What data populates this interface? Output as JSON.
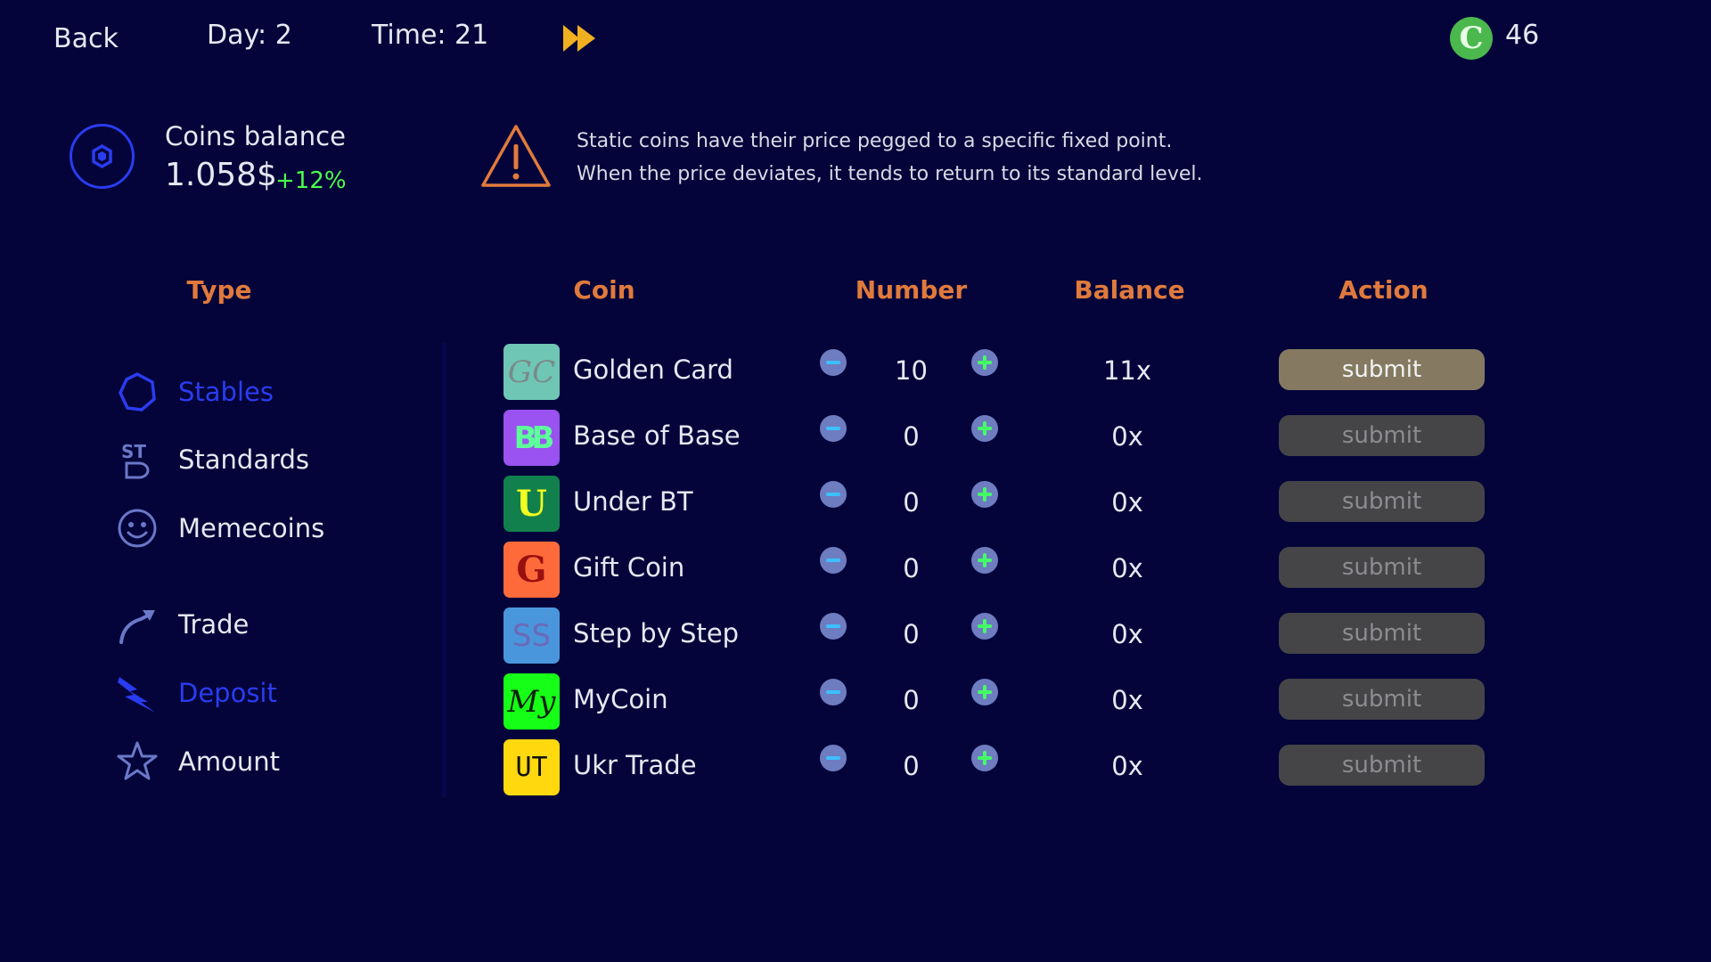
{
  "topbar": {
    "back_label": "Back",
    "day_label": "Day: 2",
    "time_label": "Time: 21",
    "fast_forward_icon": "fast-forward-icon",
    "currency_icon_letter": "C",
    "coins": "46"
  },
  "balance": {
    "label": "Coins balance",
    "value": "1.058$",
    "change": "+12%",
    "change_color": "#4cff4c"
  },
  "notice": {
    "line1": "Static coins have their price pegged to a specific fixed point.",
    "line2": "When the price deviates, it tends to return to its standard level."
  },
  "headers": {
    "type": "Type",
    "coin": "Coin",
    "number": "Number",
    "balance": "Balance",
    "action": "Action"
  },
  "sidebar": {
    "items": [
      {
        "label": "Stables",
        "icon": "hexagon-icon",
        "active": true
      },
      {
        "label": "Standards",
        "icon": "st-icon",
        "active": false
      },
      {
        "label": "Memecoins",
        "icon": "smiley-icon",
        "active": false
      },
      {
        "label": "Trade",
        "icon": "trend-arrow-icon",
        "active": false
      },
      {
        "label": "Deposit",
        "icon": "lightning-icon",
        "active": true
      },
      {
        "label": "Amount",
        "icon": "star-icon",
        "active": false
      }
    ]
  },
  "coins": [
    {
      "name": "Golden Card",
      "logo_text": "GC",
      "logo_bg": "#6fc6b4",
      "logo_fg": "#7a8a8a",
      "number": "10",
      "balance": "11x",
      "action": "submit",
      "action_enabled": true
    },
    {
      "name": "Base of Base",
      "logo_text": "BB",
      "logo_bg": "#9a52f0",
      "logo_fg": "#5dff9a",
      "number": "0",
      "balance": "0x",
      "action": "submit",
      "action_enabled": false
    },
    {
      "name": "Under BT",
      "logo_text": "U",
      "logo_bg": "#12804c",
      "logo_fg": "#f2ff20",
      "number": "0",
      "balance": "0x",
      "action": "submit",
      "action_enabled": false
    },
    {
      "name": "Gift Coin",
      "logo_text": "G",
      "logo_bg": "#ff6a3a",
      "logo_fg": "#9a1010",
      "number": "0",
      "balance": "0x",
      "action": "submit",
      "action_enabled": false
    },
    {
      "name": "Step by Step",
      "logo_text": "SS",
      "logo_bg": "#4a96dc",
      "logo_fg": "#6a6ab8",
      "number": "0",
      "balance": "0x",
      "action": "submit",
      "action_enabled": false
    },
    {
      "name": "MyCoin",
      "logo_text": "My",
      "logo_bg": "#16ff16",
      "logo_fg": "#0a200a",
      "number": "0",
      "balance": "0x",
      "action": "submit",
      "action_enabled": false
    },
    {
      "name": "Ukr Trade",
      "logo_text": "UT",
      "logo_bg": "#ffd80e",
      "logo_fg": "#111111",
      "number": "0",
      "balance": "0x",
      "action": "submit",
      "action_enabled": false
    }
  ],
  "colors": {
    "background": "#04043a",
    "header": "#e07a3c",
    "active_nav": "#2a3cf0",
    "warning": "#e07a3c"
  }
}
